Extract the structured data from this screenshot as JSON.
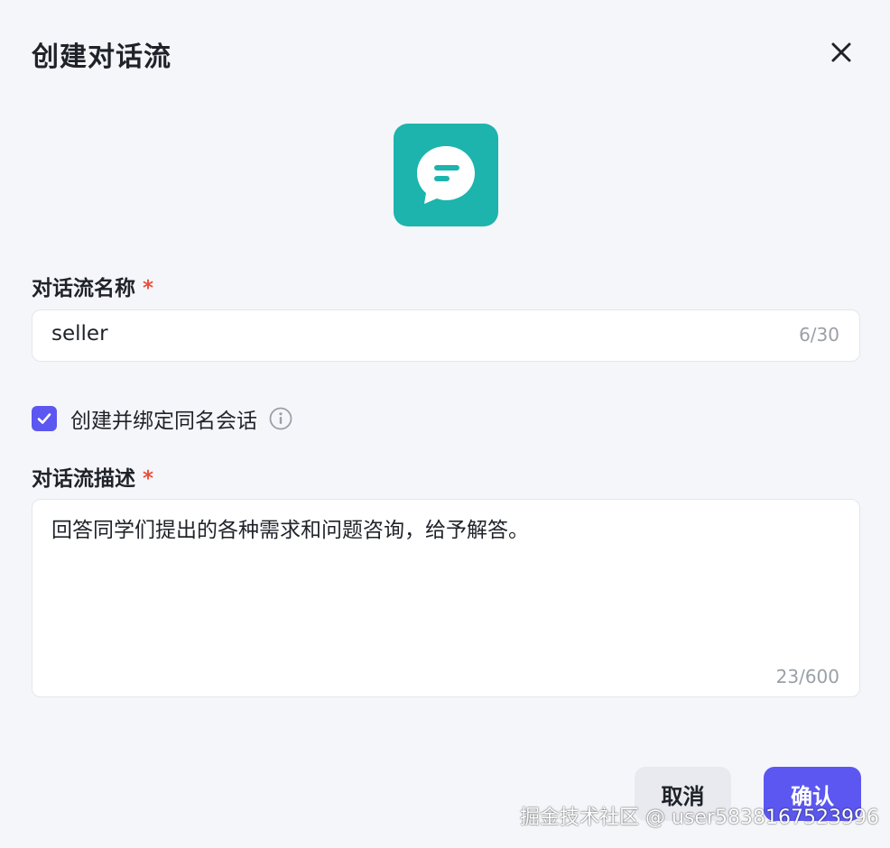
{
  "dialog": {
    "title": "创建对话流",
    "close_icon": "close-icon"
  },
  "app_icon": {
    "name": "chat-bubble-icon",
    "background": "#1cb4ac"
  },
  "name_field": {
    "label": "对话流名称",
    "required_mark": "*",
    "value": "seller",
    "counter": "6/30"
  },
  "bind_checkbox": {
    "checked": true,
    "label": "创建并绑定同名会话",
    "info_icon": "info-icon"
  },
  "description_field": {
    "label": "对话流描述",
    "required_mark": "*",
    "value": "回答同学们提出的各种需求和问题咨询，给予解答。",
    "counter": "23/600"
  },
  "footer": {
    "cancel_label": "取消",
    "confirm_label": "确认"
  },
  "watermark": "掘金技术社区 @ user5838167523996",
  "colors": {
    "accent": "#5b57f0",
    "required": "#e8513e",
    "icon_bg": "#1cb4ac"
  }
}
